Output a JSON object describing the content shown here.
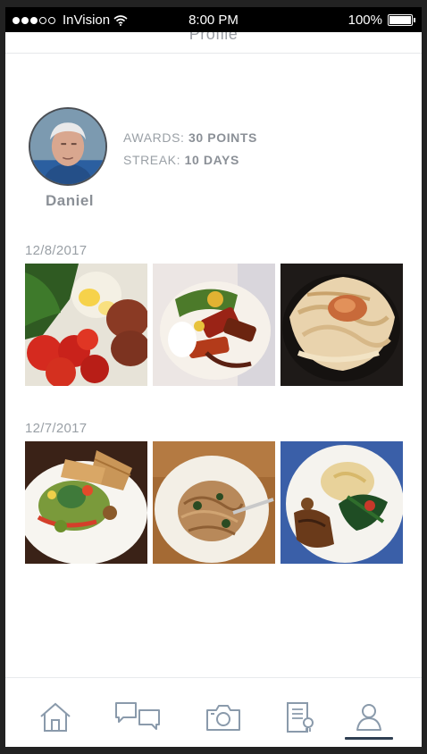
{
  "status_bar": {
    "carrier": "InVision",
    "time": "8:00 PM",
    "battery": "100%"
  },
  "header": {
    "title": "Profile"
  },
  "profile": {
    "name": "Daniel",
    "awards_label": "AWARDS:",
    "awards_value": "30 POINTS",
    "streak_label": "STREAK:",
    "streak_value": "10 DAYS"
  },
  "feed": [
    {
      "date": "12/8/2017",
      "photos": [
        "greens-eggs-tomatoes-photo",
        "grilled-vegetables-photo",
        "fettuccine-pasta-photo"
      ]
    },
    {
      "date": "12/7/2017",
      "photos": [
        "salad-flatbread-photo",
        "spaghetti-bowl-photo",
        "chicken-spinach-rice-photo"
      ]
    }
  ],
  "tabbar": {
    "tabs": [
      "home-icon",
      "chat-icon",
      "camera-icon",
      "journal-icon",
      "profile-icon"
    ],
    "active": "profile-icon"
  },
  "colors": {
    "text_muted": "#9aa0a6",
    "text_strong": "#8b9097",
    "icon": "#8a9aab",
    "active_indicator": "#2f3f52"
  }
}
